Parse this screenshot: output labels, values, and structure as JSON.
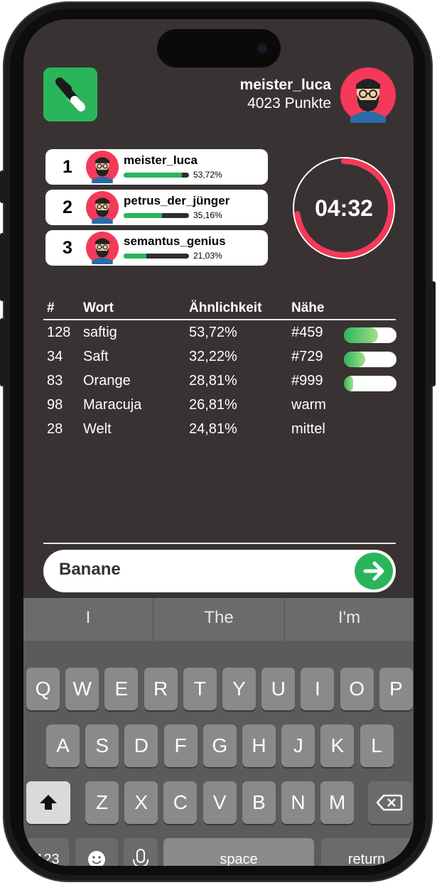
{
  "header": {
    "username": "meister_luca",
    "points": "4023 Punkte"
  },
  "leaderboard": [
    {
      "rank": "1",
      "name": "meister_luca",
      "percent": "53,72%",
      "ratio": 0.5372
    },
    {
      "rank": "2",
      "name": "petrus_der_jünger",
      "percent": "35,16%",
      "ratio": 0.3516
    },
    {
      "rank": "3",
      "name": "semantus_genius",
      "percent": "21,03%",
      "ratio": 0.2103
    }
  ],
  "timer": {
    "time": "04:32",
    "remaining_fraction": 0.73,
    "color": "#f5395a"
  },
  "table": {
    "headers": {
      "num": "#",
      "word": "Wort",
      "similarity": "Ähnlichkeit",
      "proximity": "Nähe"
    },
    "rows": [
      {
        "num": "128",
        "word": "saftig",
        "similarity": "53,72%",
        "proximity": "#459",
        "proximity_fill": 0.65
      },
      {
        "num": "34",
        "word": "Saft",
        "similarity": "32,22%",
        "proximity": "#729",
        "proximity_fill": 0.4
      },
      {
        "num": "83",
        "word": "Orange",
        "similarity": "28,81%",
        "proximity": "#999",
        "proximity_fill": 0.18
      },
      {
        "num": "98",
        "word": "Maracuja",
        "similarity": "26,81%",
        "proximity": "warm",
        "proximity_fill": null
      },
      {
        "num": "28",
        "word": "Welt",
        "similarity": "24,81%",
        "proximity": "mittel",
        "proximity_fill": null
      }
    ]
  },
  "input": {
    "value": "Banane"
  },
  "keyboard": {
    "suggestions": [
      "I",
      "The",
      "I'm"
    ],
    "row1": [
      "Q",
      "W",
      "E",
      "R",
      "T",
      "Y",
      "U",
      "I",
      "O",
      "P"
    ],
    "row2": [
      "A",
      "S",
      "D",
      "F",
      "G",
      "H",
      "J",
      "K",
      "L"
    ],
    "row3": [
      "Z",
      "X",
      "C",
      "V",
      "B",
      "N",
      "M"
    ],
    "numbers_label": "123",
    "space_label": "space",
    "return_label": "return"
  },
  "colors": {
    "accent": "#2bb55a",
    "background": "#383332",
    "avatar_bg": "#f5395a"
  },
  "icons": {
    "logo": "slash-logo-icon",
    "send": "arrow-right-icon",
    "shift": "shift-icon",
    "backspace": "backspace-icon",
    "emoji": "emoji-icon",
    "mic": "microphone-icon"
  }
}
